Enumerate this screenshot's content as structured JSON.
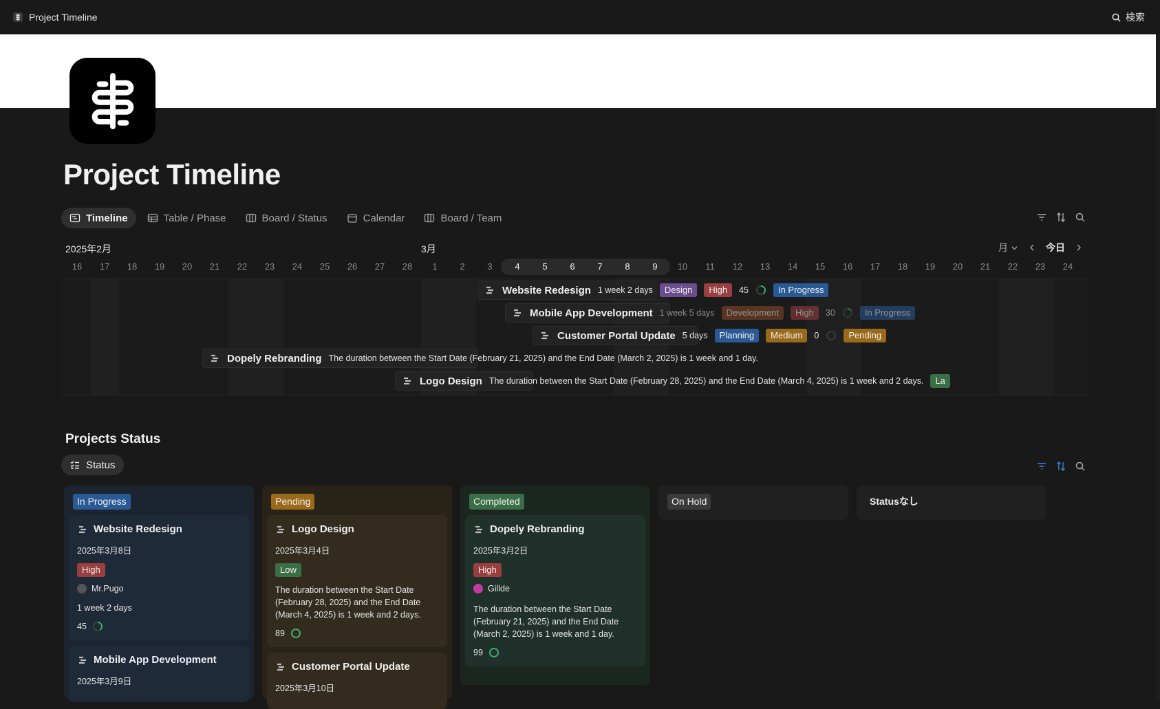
{
  "topbar": {
    "title": "Project Timeline",
    "search_label": "検索"
  },
  "page": {
    "title": "Project Timeline"
  },
  "tabs": [
    {
      "label": "Timeline",
      "icon": "timeline-icon",
      "active": true
    },
    {
      "label": "Table / Phase",
      "icon": "table-icon"
    },
    {
      "label": "Board / Status",
      "icon": "board-icon"
    },
    {
      "label": "Calendar",
      "icon": "calendar-icon"
    },
    {
      "label": "Board / Team",
      "icon": "board-icon"
    }
  ],
  "timeline": {
    "month_left": "2025年2月",
    "month_right": "3月",
    "zoom": "月",
    "today_label": "今日",
    "days": [
      "16",
      "17",
      "18",
      "19",
      "20",
      "21",
      "22",
      "23",
      "24",
      "25",
      "26",
      "27",
      "28",
      "1",
      "2",
      "3",
      "4",
      "5",
      "6",
      "7",
      "8",
      "9",
      "10",
      "11",
      "12",
      "13",
      "14",
      "15",
      "16",
      "17",
      "18",
      "19",
      "20",
      "21",
      "22",
      "23",
      "24"
    ],
    "bars": [
      {
        "name": "Website Redesign",
        "duration": "1 week 2 days",
        "phase": "Design",
        "priority": "High",
        "progress": "45",
        "status": "In Progress"
      },
      {
        "name": "Mobile App Development",
        "duration": "1 week 5 days",
        "phase": "Development",
        "priority": "High",
        "progress": "30",
        "status": "In Progress"
      },
      {
        "name": "Customer Portal Update",
        "duration": "5 days",
        "phase": "Planning",
        "priority": "Medium",
        "progress": "0",
        "status": "Pending"
      },
      {
        "name": "Dopely Rebranding",
        "duration": "The duration between the Start Date (February 21, 2025) and the End Date (March 2, 2025) is 1 week and 1 day."
      },
      {
        "name": "Logo Design",
        "duration": "The duration between the Start Date (February 28, 2025) and the End Date (March 4, 2025) is 1 week and 2 days.",
        "priority": "La"
      }
    ]
  },
  "status_section": {
    "title": "Projects Status",
    "tab_label": "Status",
    "columns": [
      {
        "label": "In Progress",
        "cards": [
          {
            "title": "Website Redesign",
            "date": "2025年3月8日",
            "priority": "High",
            "person": "Mr.Pugo",
            "duration": "1 week 2 days",
            "progress": "45"
          },
          {
            "title": "Mobile App Development",
            "date": "2025年3月9日"
          }
        ]
      },
      {
        "label": "Pending",
        "cards": [
          {
            "title": "Logo Design",
            "date": "2025年3月4日",
            "priority": "Low",
            "desc": "The duration between the Start Date (February 28, 2025) and the End Date (March 4, 2025) is 1 week and 2 days.",
            "progress": "89"
          },
          {
            "title": "Customer Portal Update",
            "date": "2025年3月10日"
          }
        ]
      },
      {
        "label": "Completed",
        "cards": [
          {
            "title": "Dopely Rebranding",
            "date": "2025年3月2日",
            "priority": "High",
            "person": "Gillde",
            "desc": "The duration between the Start Date (February 21, 2025) and the End Date (March 2, 2025) is 1 week and 1 day.",
            "progress": "99"
          }
        ]
      },
      {
        "label": "On Hold",
        "cards": []
      },
      {
        "label": "Statusなし",
        "cards": []
      }
    ]
  },
  "colors": {
    "design": "#6b4e8f",
    "high": "#9a3f3f",
    "in_progress": "#2a5a96",
    "development": "#8a4a2a",
    "planning": "#2a5a96",
    "medium": "#9a6a1a",
    "pending": "#9a6a1a",
    "low": "#3a6e45",
    "completed": "#3a6e45",
    "on_hold": "#3a3a3a",
    "accent_blue": "#3b82d6"
  }
}
